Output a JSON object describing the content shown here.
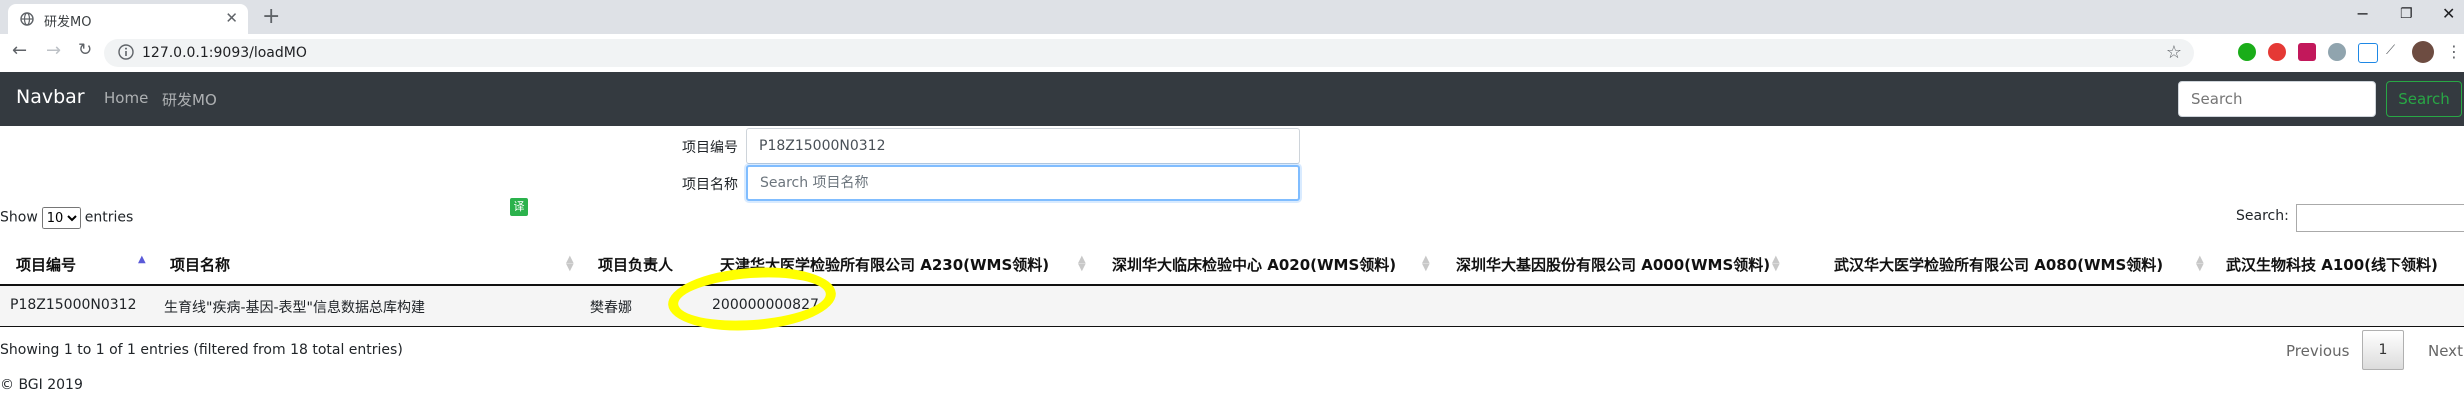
{
  "browser": {
    "tab_title": "研发MO",
    "url": "127.0.0.1:9093/loadMO"
  },
  "navbar": {
    "brand": "Navbar",
    "links": [
      "Home",
      "研发MO"
    ],
    "search_placeholder": "Search",
    "search_button": "Search"
  },
  "filters": {
    "code_label": "项目编号",
    "code_value": "P18Z15000N0312",
    "name_label": "项目名称",
    "name_placeholder": "Search 项目名称"
  },
  "translate_badge": "译",
  "table": {
    "show_label": "Show",
    "entries_label": "entries",
    "page_length": "10",
    "search_label": "Search:",
    "columns": [
      "项目编号",
      "项目名称",
      "项目负责人",
      "天津华大医学检验所有限公司 A230(WMS领料)",
      "深圳华大临床检验中心 A020(WMS领料)",
      "深圳华大基因股份有限公司 A000(WMS领料)",
      "武汉华大医学检验所有限公司 A080(WMS领料)",
      "武汉生物科技 A100(线下领料)"
    ],
    "rows": [
      {
        "code": "P18Z15000N0312",
        "name": "生育线\"疾病-基因-表型\"信息数据总库构建",
        "manager": "樊春娜",
        "a230": "200000000827"
      }
    ],
    "info": "Showing 1 to 1 of 1 entries (filtered from 18 total entries)",
    "previous": "Previous",
    "current_page": "1",
    "next": "Next"
  },
  "footer": {
    "copyright": "© BGI 2019"
  },
  "colors": {
    "navbar_bg": "#343a40",
    "search_btn": "#28a745",
    "highlight": "#ffff00",
    "focus_border": "#80bdff"
  }
}
